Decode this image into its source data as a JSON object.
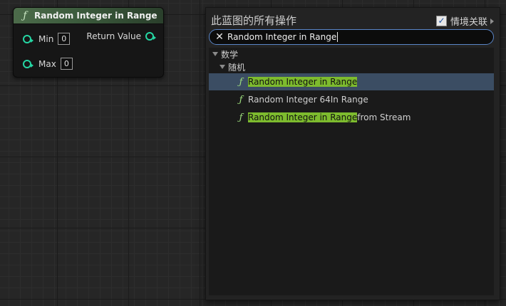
{
  "node": {
    "icon": "function-icon",
    "title": "Random Integer in Range",
    "inputs": [
      {
        "label": "Min",
        "value": "0"
      },
      {
        "label": "Max",
        "value": "0"
      }
    ],
    "output": {
      "label": "Return Value"
    }
  },
  "panel": {
    "title": "此蓝图的所有操作",
    "context_label": "情境关联",
    "context_checked": true,
    "search": {
      "value": "Random Integer in Range"
    },
    "tree": {
      "category": "数学",
      "subcategory": "随机",
      "items": [
        {
          "highlight": "Random Integer in Range",
          "rest": "",
          "selected": true
        },
        {
          "highlight": "",
          "rest": "Random Integer 64In Range",
          "selected": false
        },
        {
          "highlight": "Random Integer in Range",
          "rest": " from Stream",
          "selected": false
        }
      ]
    }
  },
  "colors": {
    "pin": "#25d6a3",
    "highlight": "#7dbb2e",
    "selection": "#3b4d63",
    "focus_border": "#5a86c8"
  }
}
